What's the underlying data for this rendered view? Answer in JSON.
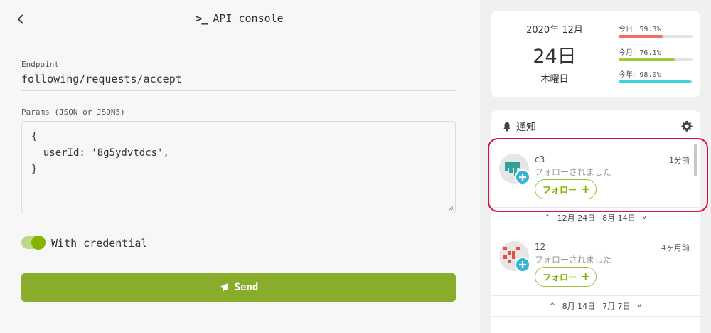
{
  "console": {
    "title": "API console",
    "title_icon": ">_",
    "endpoint_label": "Endpoint",
    "endpoint_value": "following/requests/accept",
    "params_label": "Params (JSON or JSON5)",
    "params_lines": [
      "{",
      "  userId: '8g5ydvtdcs',",
      "}"
    ],
    "credential_label": "With credential",
    "credential_on": true,
    "send_label": "Send"
  },
  "date_widget": {
    "year_month": "2020年 12月",
    "day": "24日",
    "weekday": "木曜日",
    "stats": [
      {
        "label": "今日:",
        "value": "59.3%",
        "fraction": 0.593,
        "color": "#f07068"
      },
      {
        "label": "今月:",
        "value": "76.1%",
        "fraction": 0.761,
        "color": "#9ccc3c"
      },
      {
        "label": "今年:",
        "value": "98.0%",
        "fraction": 0.98,
        "color": "#3cd2d8"
      }
    ]
  },
  "notifications": {
    "title": "通知",
    "items": [
      {
        "user": "c3",
        "time": "1分前",
        "message": "フォローされました",
        "follow_label": "フォロー"
      },
      {
        "user": "12",
        "time": "4ヶ月前",
        "message": "フォローされました",
        "follow_label": "フォロー"
      }
    ],
    "separators": [
      {
        "newer": "12月 24日",
        "older": "8月 14日"
      },
      {
        "newer": "8月 14日",
        "older": "7月 7日"
      }
    ]
  },
  "colors": {
    "accent": "#86b300",
    "send_button": "#87ad2a",
    "badge": "#35b4d6",
    "highlight": "#d9123a"
  }
}
